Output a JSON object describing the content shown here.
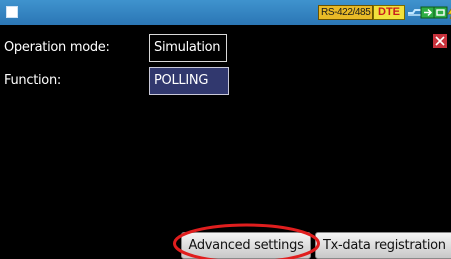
{
  "status_bar": {
    "interface_label": "RS-422/485",
    "mode_label": "DTE",
    "accent_color": "#2b76b5"
  },
  "settings": {
    "operation_mode_label": "Operation mode:",
    "operation_mode_value": "Simulation",
    "function_label": "Function:",
    "function_value": "POLLING"
  },
  "buttons": {
    "advanced_settings": "Advanced settings",
    "tx_data_registration": "Tx-data registration"
  },
  "icons": [
    "menu-icon",
    "cable-icon",
    "network-icon",
    "storage-icon",
    "power-icon",
    "close-icon"
  ]
}
